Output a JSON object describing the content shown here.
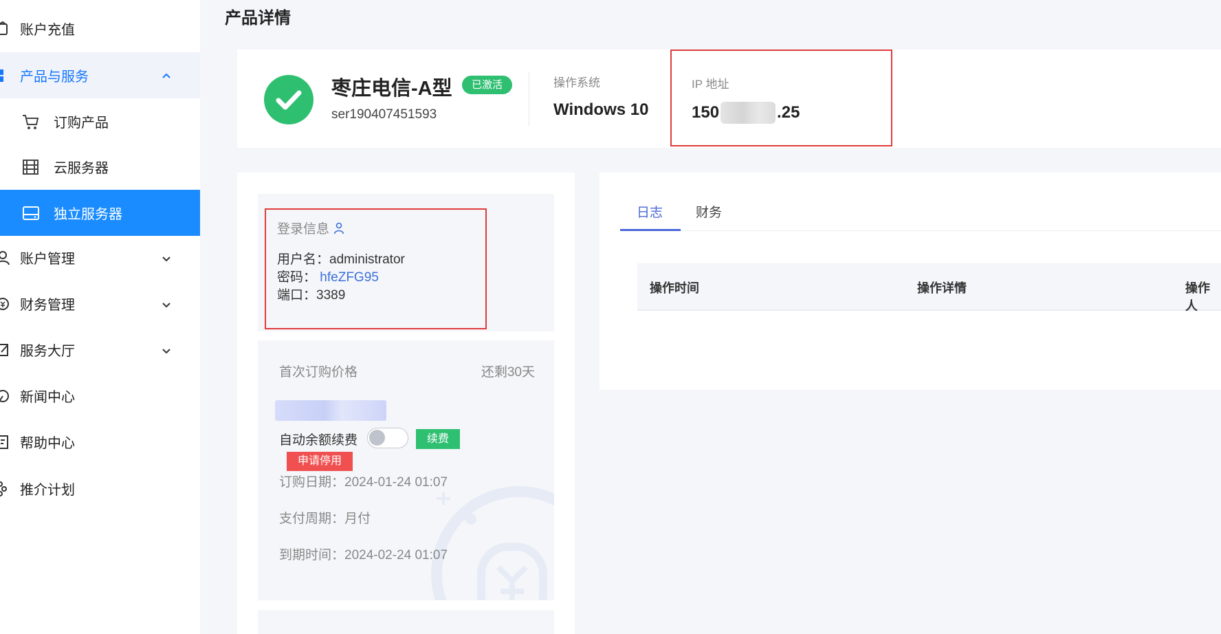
{
  "page_title": "产品详情",
  "sidebar": {
    "items": [
      {
        "label": "账户充值",
        "icon": "wallet-icon"
      },
      {
        "label": "产品与服务",
        "icon": "grid-icon",
        "expanded": true
      },
      {
        "label": "订购产品",
        "icon": "cart-icon",
        "sub": true
      },
      {
        "label": "云服务器",
        "icon": "server-rack-icon",
        "sub": true
      },
      {
        "label": "独立服务器",
        "icon": "hard-drive-icon",
        "sub": true,
        "active": true
      },
      {
        "label": "账户管理",
        "icon": "user-icon"
      },
      {
        "label": "财务管理",
        "icon": "money-icon"
      },
      {
        "label": "服务大厅",
        "icon": "edit-icon"
      },
      {
        "label": "新闻中心",
        "icon": "news-icon"
      },
      {
        "label": "帮助中心",
        "icon": "help-icon"
      },
      {
        "label": "推介计划",
        "icon": "share-icon"
      }
    ]
  },
  "product": {
    "name": "枣庄电信-A型",
    "status": "已激活",
    "serial": "ser190407451593",
    "os_label": "操作系统",
    "os_value": "Windows 10",
    "ip_label": "IP 地址",
    "ip_prefix": "150",
    "ip_suffix": ".25"
  },
  "login": {
    "title": "登录信息",
    "username_label": "用户名：",
    "username": "administrator",
    "password_label": "密码：",
    "password": "hfeZFG95",
    "port_label": "端口：",
    "port": "3389"
  },
  "billing": {
    "first_price_label": "首次订购价格",
    "days_left": "还剩30天",
    "auto_renew_label": "自动余额续费",
    "auto_renew_on": false,
    "renew_button": "续费",
    "suspend_button": "申请停用",
    "order_date_label": "订购日期：",
    "order_date": "2024-01-24 01:07",
    "pay_cycle_label": "支付周期：",
    "pay_cycle": "月付",
    "expire_label": "到期时间：",
    "expire_date": "2024-02-24 01:07"
  },
  "log": {
    "tabs": [
      "日志",
      "财务"
    ],
    "active_tab": 0,
    "columns": [
      "操作时间",
      "操作详情",
      "操作人"
    ]
  },
  "colors": {
    "primary": "#1a8cff",
    "success": "#2fbf71",
    "danger": "#f05050",
    "highlight_box": "#e03a3a",
    "tab_accent": "#4a66d8"
  }
}
